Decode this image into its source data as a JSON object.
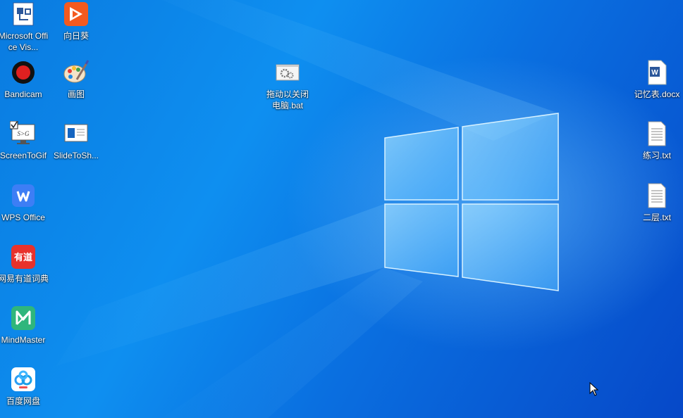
{
  "desktop": {
    "icons": [
      {
        "label": "Microsoft Office Vis...",
        "icon": "visio-icon"
      },
      {
        "label": "向日葵",
        "icon": "sunflower-icon"
      },
      {
        "label": "Bandicam",
        "icon": "bandicam-icon"
      },
      {
        "label": "画图",
        "icon": "paint-icon"
      },
      {
        "label": "ScreenToGif",
        "icon": "screentogif-icon"
      },
      {
        "label": "SlideToSh...",
        "icon": "slidetoshow-icon"
      },
      {
        "label": "WPS Office",
        "icon": "wps-icon"
      },
      {
        "label": "网易有道词典",
        "icon": "youdao-icon"
      },
      {
        "label": "MindMaster",
        "icon": "mindmaster-icon"
      },
      {
        "label": "百度网盘",
        "icon": "baidu-netdisk-icon"
      },
      {
        "label": "拖动以关闭电脑.bat",
        "icon": "batch-file-icon"
      },
      {
        "label": "记忆表.docx",
        "icon": "word-document-icon"
      },
      {
        "label": "练习.txt",
        "icon": "text-file-icon"
      },
      {
        "label": "二层.txt",
        "icon": "text-file-icon"
      }
    ],
    "youdao_glyph": "有道",
    "screentogif_glyph": "S>G",
    "word_glyph": "W",
    "colors": {
      "background": "#0a7be0",
      "wps": "#3d7ef5",
      "sunflower": "#f45a1f",
      "youdao": "#e8322c",
      "mindmaster": "#2fb67c"
    }
  }
}
